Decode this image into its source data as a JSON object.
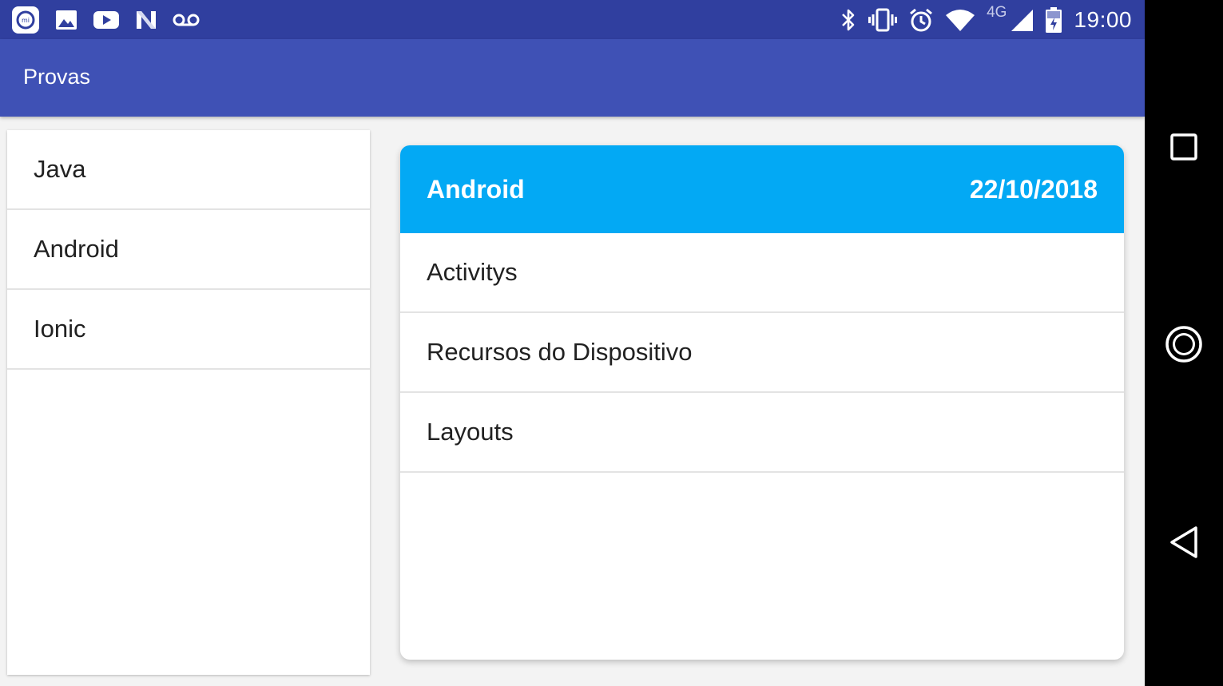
{
  "status_bar": {
    "time": "19:00",
    "network_type": "4G",
    "left_icons": [
      "mi-app-icon",
      "gallery-icon",
      "youtube-icon",
      "n-app-icon",
      "voicemail-icon"
    ],
    "right_icons": [
      "bluetooth-icon",
      "vibrate-icon",
      "alarm-icon",
      "wifi-icon",
      "cell-signal-icon",
      "battery-charging-icon"
    ]
  },
  "app_bar": {
    "title": "Provas"
  },
  "left_list": {
    "items": [
      {
        "label": "Java"
      },
      {
        "label": "Android"
      },
      {
        "label": "Ionic"
      }
    ]
  },
  "detail_card": {
    "title": "Android",
    "date": "22/10/2018",
    "items": [
      {
        "label": "Activitys"
      },
      {
        "label": "Recursos do Dispositivo"
      },
      {
        "label": "Layouts"
      }
    ]
  },
  "nav_bar": {
    "buttons": [
      "recents-icon",
      "home-icon",
      "back-icon"
    ]
  },
  "colors": {
    "status_bar": "#303f9f",
    "app_bar": "#3f51b5",
    "card_header": "#03a9f4",
    "divider": "#e3e3e3"
  }
}
